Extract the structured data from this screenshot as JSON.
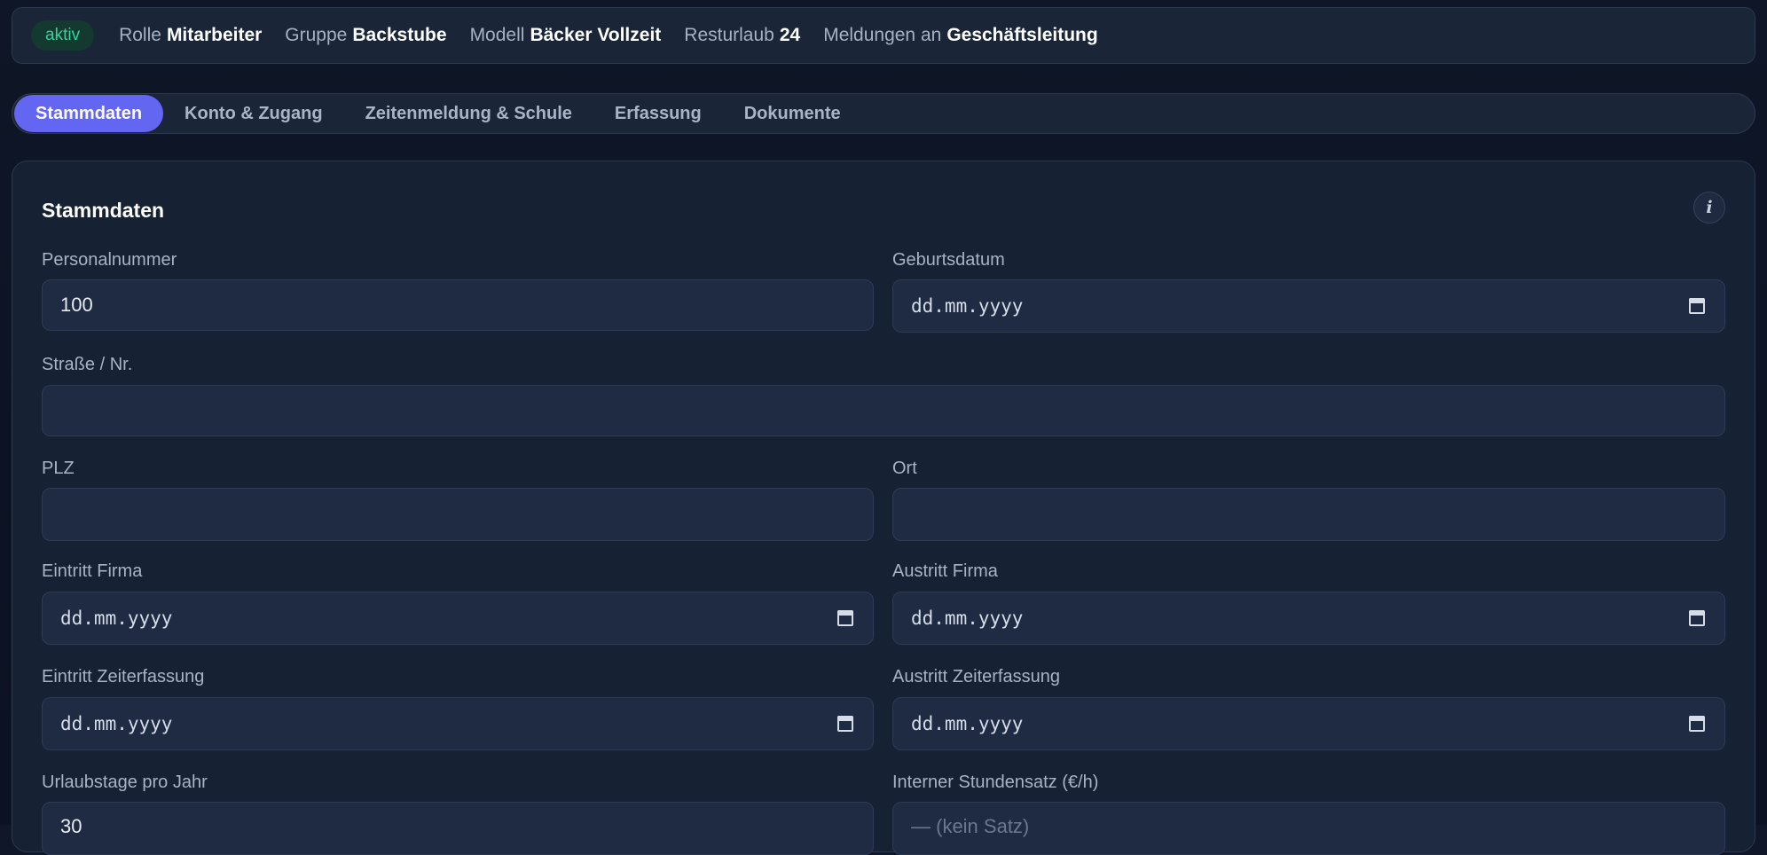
{
  "status": {
    "badge": "aktiv",
    "items": [
      {
        "label": "Rolle",
        "value": "Mitarbeiter"
      },
      {
        "label": "Gruppe",
        "value": "Backstube"
      },
      {
        "label": "Modell",
        "value": "Bäcker Vollzeit"
      },
      {
        "label": "Resturlaub",
        "value": "24"
      },
      {
        "label": "Meldungen an",
        "value": "Geschäftsleitung"
      }
    ]
  },
  "tabs": [
    {
      "label": "Stammdaten",
      "active": true
    },
    {
      "label": "Konto & Zugang",
      "active": false
    },
    {
      "label": "Zeitenmeldung & Schule",
      "active": false
    },
    {
      "label": "Erfassung",
      "active": false
    },
    {
      "label": "Dokumente",
      "active": false
    }
  ],
  "panel": {
    "title": "Stammdaten",
    "info_icon": "i",
    "fields": {
      "personalnummer": {
        "label": "Personalnummer",
        "value": "100"
      },
      "geburtsdatum": {
        "label": "Geburtsdatum",
        "value": "dd.mm.yyyy"
      },
      "strasse": {
        "label": "Straße / Nr.",
        "value": ""
      },
      "plz": {
        "label": "PLZ",
        "value": ""
      },
      "ort": {
        "label": "Ort",
        "value": ""
      },
      "eintritt_firma": {
        "label": "Eintritt Firma",
        "value": "dd.mm.yyyy"
      },
      "austritt_firma": {
        "label": "Austritt Firma",
        "value": "dd.mm.yyyy"
      },
      "eintritt_zeiterfassung": {
        "label": "Eintritt Zeiterfassung",
        "value": "dd.mm.yyyy"
      },
      "austritt_zeiterfassung": {
        "label": "Austritt Zeiterfassung",
        "value": "dd.mm.yyyy"
      },
      "urlaubstage": {
        "label": "Urlaubstage pro Jahr",
        "value": "30"
      },
      "stundensatz": {
        "label": "Interner Stundensatz (€/h)",
        "value": "— (kein Satz)"
      }
    }
  },
  "colors": {
    "accent": "#6366f1",
    "status_green": "#34d399",
    "background": "#0f1729",
    "panel": "#172134"
  }
}
